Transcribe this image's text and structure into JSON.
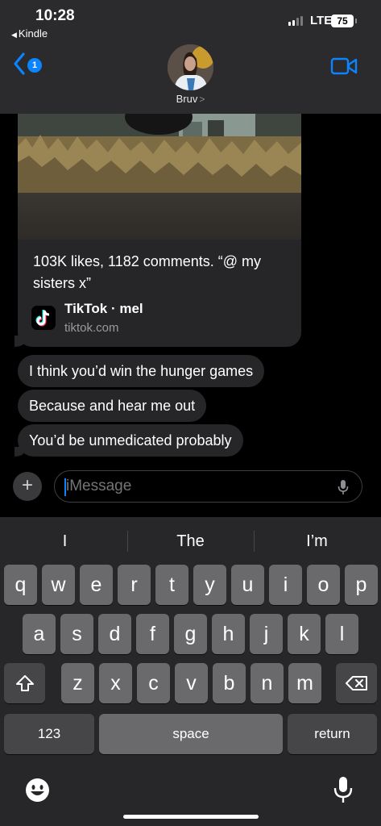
{
  "status_bar": {
    "time": "10:28",
    "back_app": "Kindle",
    "network": "LTE",
    "battery": "75"
  },
  "header": {
    "unread_count": "1",
    "contact_name": "Bruv"
  },
  "conversation": {
    "link_card": {
      "title": "103K likes, 1182 comments. “@ my sisters x”",
      "source": "TikTok · mel",
      "domain": "tiktok.com"
    },
    "messages": [
      "I think you’d win the hunger games",
      "Because and hear me out",
      "You’d be unmedicated probably"
    ]
  },
  "compose": {
    "placeholder": "iMessage"
  },
  "keyboard": {
    "suggestions": [
      "I",
      "The",
      "I’m"
    ],
    "row1": [
      "q",
      "w",
      "e",
      "r",
      "t",
      "y",
      "u",
      "i",
      "o",
      "p"
    ],
    "row2": [
      "a",
      "s",
      "d",
      "f",
      "g",
      "h",
      "j",
      "k",
      "l"
    ],
    "row3": [
      "z",
      "x",
      "c",
      "v",
      "b",
      "n",
      "m"
    ],
    "numbers_key": "123",
    "space_key": "space",
    "return_key": "return"
  }
}
